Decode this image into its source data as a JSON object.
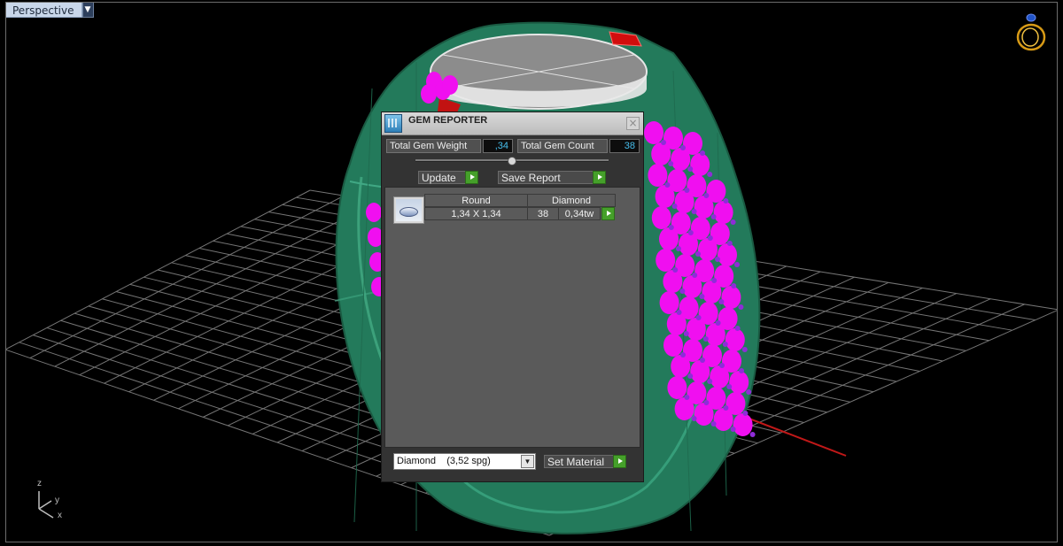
{
  "viewport": {
    "name": "Perspective"
  },
  "axis_labels": {
    "z": "z",
    "y": "y",
    "x": "x"
  },
  "gem_reporter": {
    "title": "GEM REPORTER",
    "total_gem_weight_label": "Total Gem Weight",
    "total_gem_weight_value": ",34",
    "total_gem_count_label": "Total Gem Count",
    "total_gem_count_value": "38",
    "update_label": "Update",
    "save_report_label": "Save Report",
    "table": {
      "headers": [
        "Round",
        "Diamond"
      ],
      "rows": [
        {
          "size": "1,34 X 1,34",
          "count": "38",
          "weight": "0,34tw"
        }
      ]
    },
    "material_select_value": "Diamond    (3,52 spg)",
    "set_material_label": "Set Material"
  },
  "colors": {
    "ring_green": "#247a5c",
    "gem_magenta": "#ff00ff",
    "play_button": "#45a02a",
    "value_text": "#46bcea"
  }
}
